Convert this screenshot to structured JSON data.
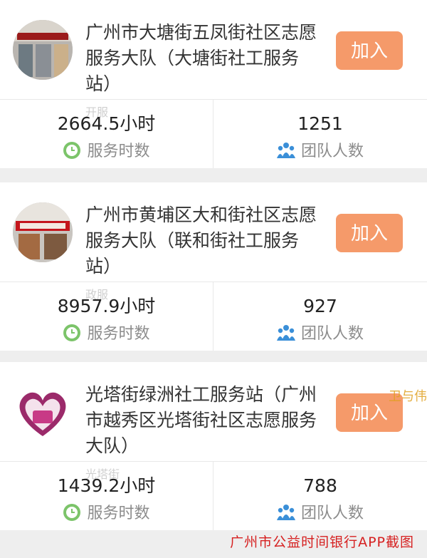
{
  "teams": [
    {
      "name": "广州市大塘街五凤街社区志愿服务大队（大塘街社工服务站）",
      "join_label": "加入",
      "hours_value": "2664.5小时",
      "hours_label": "服务时数",
      "members_value": "1251",
      "members_label": "团队人数",
      "ghost_text": "开服"
    },
    {
      "name": "广州市黄埔区大和街社区志愿服务大队（联和街社工服务站）",
      "join_label": "加入",
      "hours_value": "8957.9小时",
      "hours_label": "服务时数",
      "members_value": "927",
      "members_label": "团队人数",
      "ghost_text": "政服"
    },
    {
      "name": "光塔街绿洲社工服务站（广州市越秀区光塔街社区志愿服务大队）",
      "join_label": "加入",
      "hours_value": "1439.2小时",
      "hours_label": "服务时数",
      "members_value": "788",
      "members_label": "团队人数",
      "ghost_text": "光塔街"
    }
  ],
  "side_mark": "卫与伟",
  "footer_caption": "广州市公益时间银行APP截图",
  "icons": {
    "hours": "clock-icon",
    "members": "people-icon"
  },
  "colors": {
    "join_button": "#f59a6a",
    "clock_icon": "#7cc46a",
    "people_icon": "#3a8fd8",
    "caption": "#d62020"
  }
}
